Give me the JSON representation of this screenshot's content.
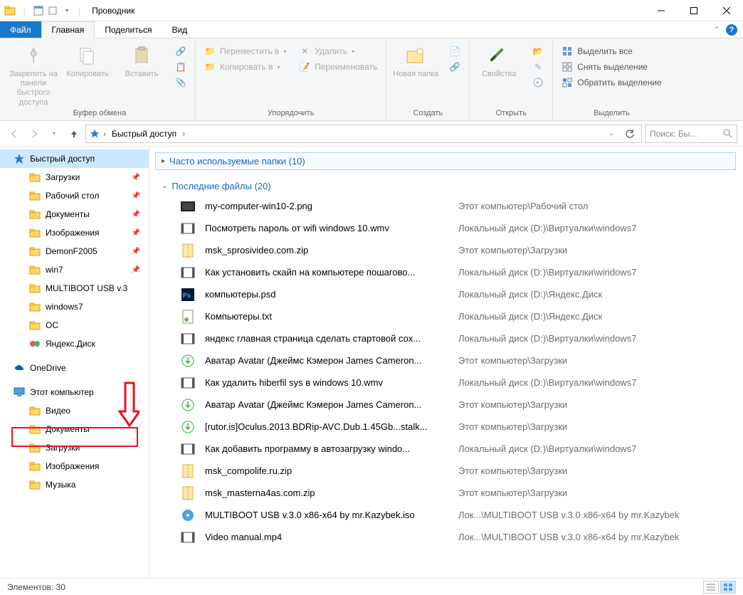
{
  "window": {
    "title": "Проводник"
  },
  "tabs": {
    "file": "Файл",
    "home": "Главная",
    "share": "Поделиться",
    "view": "Вид"
  },
  "ribbon": {
    "clipboard": {
      "pin": "Закрепить на панели быстрого доступа",
      "copy": "Копировать",
      "paste": "Вставить",
      "label": "Буфер обмена"
    },
    "organize": {
      "moveTo": "Переместить в",
      "copyTo": "Копировать в",
      "delete": "Удалить",
      "rename": "Переименовать",
      "label": "Упорядочить"
    },
    "new": {
      "newFolder": "Новая папка",
      "label": "Создать"
    },
    "open": {
      "properties": "Свойства",
      "label": "Открыть"
    },
    "select": {
      "selectAll": "Выделить все",
      "selectNone": "Снять выделение",
      "invert": "Обратить выделение",
      "label": "Выделить"
    }
  },
  "address": {
    "crumb1": "Быстрый доступ"
  },
  "search": {
    "placeholder": "Поиск: Бы..."
  },
  "sidebar": {
    "quickAccess": "Быстрый доступ",
    "items": [
      {
        "label": "Загрузки",
        "pinned": true
      },
      {
        "label": "Рабочий стол",
        "pinned": true
      },
      {
        "label": "Документы",
        "pinned": true
      },
      {
        "label": "Изображения",
        "pinned": true
      },
      {
        "label": "DemonF2005",
        "pinned": true
      },
      {
        "label": "win7",
        "pinned": true
      },
      {
        "label": "MULTIBOOT USB v.3",
        "pinned": false
      },
      {
        "label": "windows7",
        "pinned": false
      },
      {
        "label": "OC",
        "pinned": false
      },
      {
        "label": "Яндекс.Диск",
        "pinned": false
      }
    ],
    "onedrive": "OneDrive",
    "thispc": "Этот компьютер",
    "pcItems": [
      "Видео",
      "Документы",
      "Загрузки",
      "Изображения",
      "Музыка"
    ]
  },
  "groups": {
    "frequent": "Часто используемые папки (10)",
    "recent": "Последние файлы (20)"
  },
  "files": [
    {
      "icon": "img",
      "name": "my-computer-win10-2.png",
      "path": "Этот компьютер\\Рабочий стол"
    },
    {
      "icon": "video",
      "name": "Посмотреть пароль от wifi windows 10.wmv",
      "path": "Локальный диск (D:)\\Виртуалки\\windows7"
    },
    {
      "icon": "zip",
      "name": "msk_sprosivideo.com.zip",
      "path": "Этот компьютер\\Загрузки"
    },
    {
      "icon": "video",
      "name": "Как установить скайп на компьютере пошагово...",
      "path": "Локальный диск (D:)\\Виртуалки\\windows7"
    },
    {
      "icon": "psd",
      "name": "компьютеры.psd",
      "path": "Локальный диск (D:)\\Яндекс.Диск"
    },
    {
      "icon": "txt",
      "name": "Компьютеры.txt",
      "path": "Локальный диск (D:)\\Яндекс.Диск"
    },
    {
      "icon": "video",
      "name": "яндекс главная страница сделать стартовой сох...",
      "path": "Локальный диск (D:)\\Виртуалки\\windows7"
    },
    {
      "icon": "torrent",
      "name": "Аватар Avatar (Джеймс Кэмерон James Cameron...",
      "path": "Этот компьютер\\Загрузки"
    },
    {
      "icon": "video",
      "name": "Как удалить hiberfil sys в windows 10.wmv",
      "path": "Локальный диск (D:)\\Виртуалки\\windows7"
    },
    {
      "icon": "torrent",
      "name": "Аватар Avatar (Джеймс Кэмерон James Cameron...",
      "path": "Этот компьютер\\Загрузки"
    },
    {
      "icon": "torrent",
      "name": "[rutor.is]Oculus.2013.BDRip-AVC.Dub.1.45Gb...stalk...",
      "path": "Этот компьютер\\Загрузки"
    },
    {
      "icon": "video",
      "name": "Как добавить программу в автозагрузку windo...",
      "path": "Локальный диск (D:)\\Виртуалки\\windows7"
    },
    {
      "icon": "zip",
      "name": "msk_compolife.ru.zip",
      "path": "Этот компьютер\\Загрузки"
    },
    {
      "icon": "zip",
      "name": "msk_masterna4as.com.zip",
      "path": "Этот компьютер\\Загрузки"
    },
    {
      "icon": "iso",
      "name": "MULTIBOOT USB v.3.0 x86-x64 by mr.Kazybek.iso",
      "path": "Лок...\\MULTIBOOT USB v.3.0 x86-x64 by mr.Kazybek"
    },
    {
      "icon": "video",
      "name": "Video manual.mp4",
      "path": "Лок...\\MULTIBOOT USB v.3.0 x86-x64 by mr.Kazybek"
    }
  ],
  "status": {
    "count": "Элементов: 30"
  }
}
